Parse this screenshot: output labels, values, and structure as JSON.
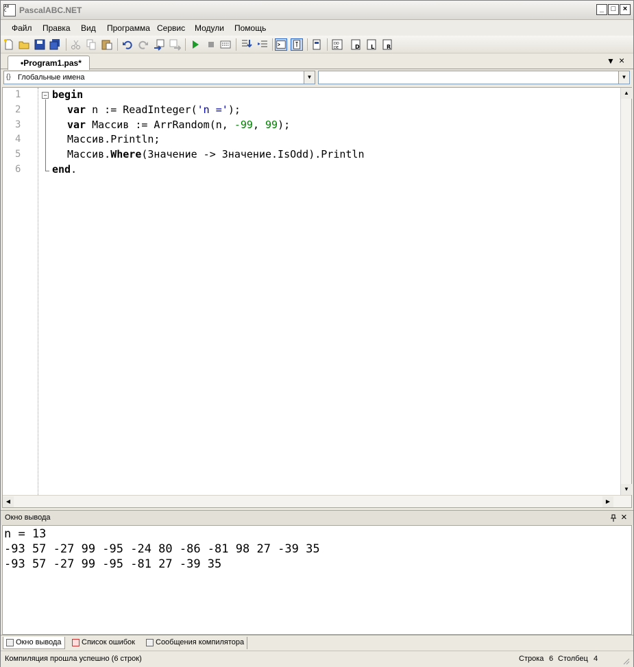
{
  "window": {
    "title": "PascalABC.NET",
    "minimize": "_",
    "maximize": "□",
    "close": "×"
  },
  "menu": [
    "Файл",
    "Правка",
    "Вид",
    "Программа",
    "Сервис",
    "Модули",
    "Помощь"
  ],
  "toolbar": {
    "icons": [
      "new-file-icon",
      "open-icon",
      "save-icon",
      "save-all-icon",
      "cut-icon",
      "copy-icon",
      "paste-icon",
      "undo-icon",
      "redo-icon",
      "format-icon",
      "navigate-icon",
      "run-icon",
      "stop-icon",
      "debug-icon",
      "step-into-icon",
      "step-over-icon",
      "console-icon",
      "text-icon",
      "form-icon",
      "dll-icon",
      "code-icon",
      "library-icon",
      "reference-icon"
    ]
  },
  "document_tab": {
    "label": "•Program1.pas*",
    "dropdown": "▼",
    "close": "×"
  },
  "combos": {
    "left_text": "Глобальные имена",
    "left_icon": "{}",
    "right_text": ""
  },
  "editor": {
    "line_numbers": [
      "1",
      "2",
      "3",
      "4",
      "5",
      "6"
    ],
    "code": {
      "l1_kw": "begin",
      "l2_kw": "var",
      "l2_a": " n := ReadInteger(",
      "l2_str": "'n ='",
      "l2_b": ");",
      "l3_kw": "var",
      "l3_a": " Массив := ArrRandom(n, ",
      "l3_n1": "-99",
      "l3_b": ", ",
      "l3_n2": "99",
      "l3_c": ");",
      "l4": "Массив.Println;",
      "l5_a": "Массив.",
      "l5_kw": "Where",
      "l5_b": "(Значение -> Значение.IsOdd).Println",
      "l6_kw": "end",
      "l6_b": "."
    }
  },
  "output_pane": {
    "title": "Окно вывода",
    "pin": "📌",
    "close": "×",
    "lines": [
      "n = 13",
      "-93 57 -27 99 -95 -24 80 -86 -81 98 27 -39 35",
      "-93 57 -27 99 -95 -81 27 -39 35"
    ]
  },
  "bottom_tabs": [
    "Окно вывода",
    "Список ошибок",
    "Сообщения компилятора"
  ],
  "status": {
    "message": "Компиляция прошла успешно (6 строк)",
    "row_label": "Строка",
    "row_value": "6",
    "col_label": "Столбец",
    "col_value": "4"
  }
}
